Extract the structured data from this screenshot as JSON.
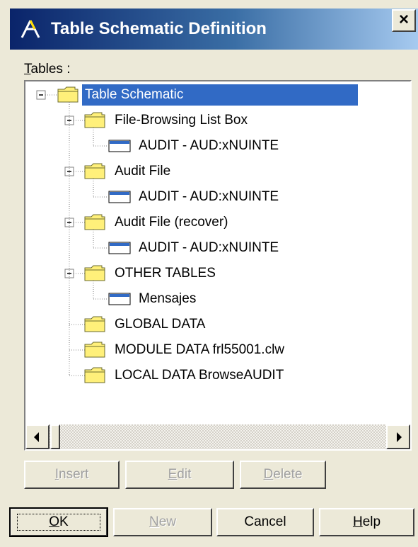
{
  "window": {
    "title": "Table Schematic Definition",
    "close_glyph": "×",
    "title_icon": "clarion-app-icon"
  },
  "tables_label": {
    "mnemonic": "T",
    "rest": "ables :"
  },
  "tree": {
    "root": {
      "label": "Table Schematic",
      "selected": true,
      "expanded": true,
      "icon": "folder-icon"
    },
    "items": [
      {
        "label": "File-Browsing List Box",
        "expanded": true,
        "icon": "folder-icon",
        "children": [
          {
            "label": "AUDIT - AUD:xNUINTE",
            "icon": "table-icon"
          }
        ]
      },
      {
        "label": "Audit File",
        "expanded": true,
        "icon": "folder-icon",
        "children": [
          {
            "label": "AUDIT - AUD:xNUINTE",
            "icon": "table-icon"
          }
        ]
      },
      {
        "label": "Audit File (recover)",
        "expanded": true,
        "icon": "folder-icon",
        "children": [
          {
            "label": "AUDIT - AUD:xNUINTE",
            "icon": "table-icon"
          }
        ]
      },
      {
        "label": "OTHER TABLES",
        "expanded": true,
        "icon": "folder-icon",
        "children": [
          {
            "label": "Mensajes",
            "icon": "table-icon"
          }
        ]
      },
      {
        "label": "GLOBAL DATA",
        "icon": "folder-icon"
      },
      {
        "label": "MODULE DATA frl55001.clw",
        "icon": "folder-icon"
      },
      {
        "label": "LOCAL DATA BrowseAUDIT",
        "icon": "folder-icon"
      }
    ]
  },
  "action_buttons": [
    {
      "mnemonic": "I",
      "rest": "nsert",
      "disabled": true
    },
    {
      "mnemonic": "E",
      "rest": "dit",
      "disabled": true
    },
    {
      "mnemonic": "D",
      "rest": "elete",
      "disabled": true
    }
  ],
  "dialog_buttons": [
    {
      "mnemonic": "O",
      "rest": "K",
      "default": true
    },
    {
      "mnemonic": "N",
      "rest": "ew",
      "disabled": true
    },
    {
      "mnemonic": "",
      "rest": "Cancel"
    },
    {
      "mnemonic": "H",
      "rest": "elp"
    }
  ],
  "colors": {
    "selection": "#316ac5",
    "titlebar_start": "#0a246a",
    "titlebar_end": "#a6caf0",
    "folder": "#fff07a",
    "dialog_bg": "#ece9d8"
  }
}
